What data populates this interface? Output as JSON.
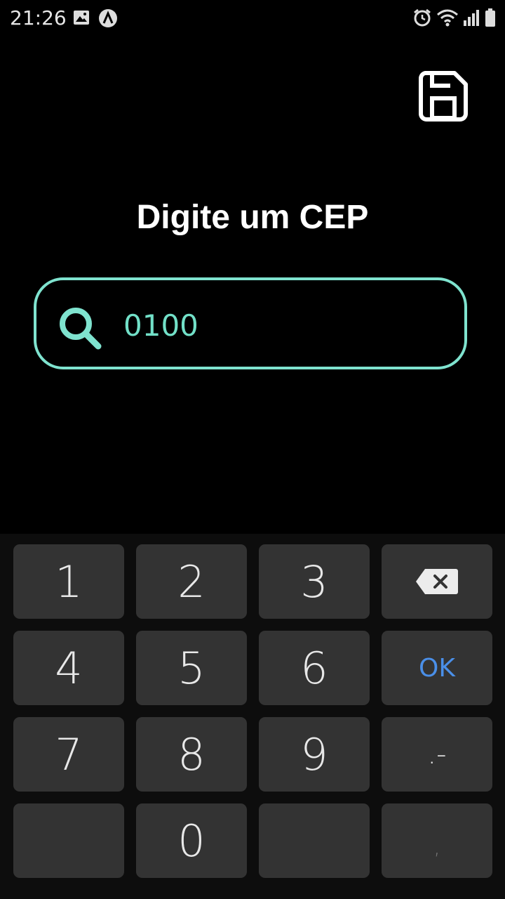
{
  "status_bar": {
    "time": "21:26",
    "icons": [
      "image-icon",
      "app-a-icon",
      "alarm-icon",
      "wifi-icon",
      "signal-icon",
      "battery-icon"
    ]
  },
  "header": {
    "save_icon": "save-icon"
  },
  "main": {
    "title": "Digite um CEP",
    "search": {
      "icon": "search-icon",
      "value": "0100"
    }
  },
  "keyboard": {
    "keys": {
      "k1": "1",
      "k2": "2",
      "k3": "3",
      "backspace": "backspace-icon",
      "k4": "4",
      "k5": "5",
      "k6": "6",
      "ok": "OK",
      "k7": "7",
      "k8": "8",
      "k9": "9",
      "dotdash": ".-",
      "k0": "0",
      "comma": ","
    }
  },
  "colors": {
    "background": "#000000",
    "accent": "#7fe3cf",
    "key_bg": "#333333",
    "ok_blue": "#4a8fe8"
  }
}
